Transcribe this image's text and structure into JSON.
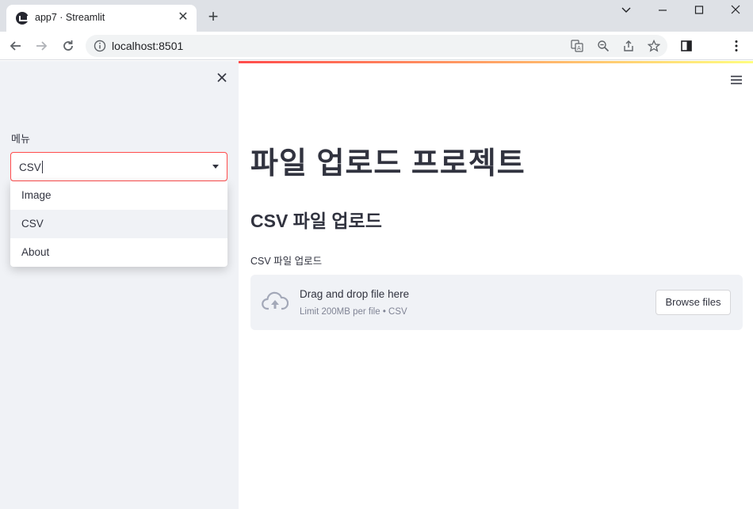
{
  "browser": {
    "tab_title": "app7 · Streamlit",
    "new_tab_icon": "+",
    "url": "localhost:8501"
  },
  "sidebar": {
    "menu_label": "메뉴",
    "select_value": "CSV",
    "options": [
      {
        "label": "Image"
      },
      {
        "label": "CSV"
      },
      {
        "label": "About"
      }
    ]
  },
  "main": {
    "title": "파일 업로드 프로젝트",
    "subtitle": "CSV 파일 업로드",
    "uploader_label": "CSV 파일 업로드",
    "dropzone_title": "Drag and drop file here",
    "dropzone_limit": "Limit 200MB per file • CSV",
    "browse_button": "Browse files"
  },
  "colors": {
    "accent": "#ff4b4b",
    "sidebar_bg": "#f0f2f6",
    "text": "#31333f"
  }
}
